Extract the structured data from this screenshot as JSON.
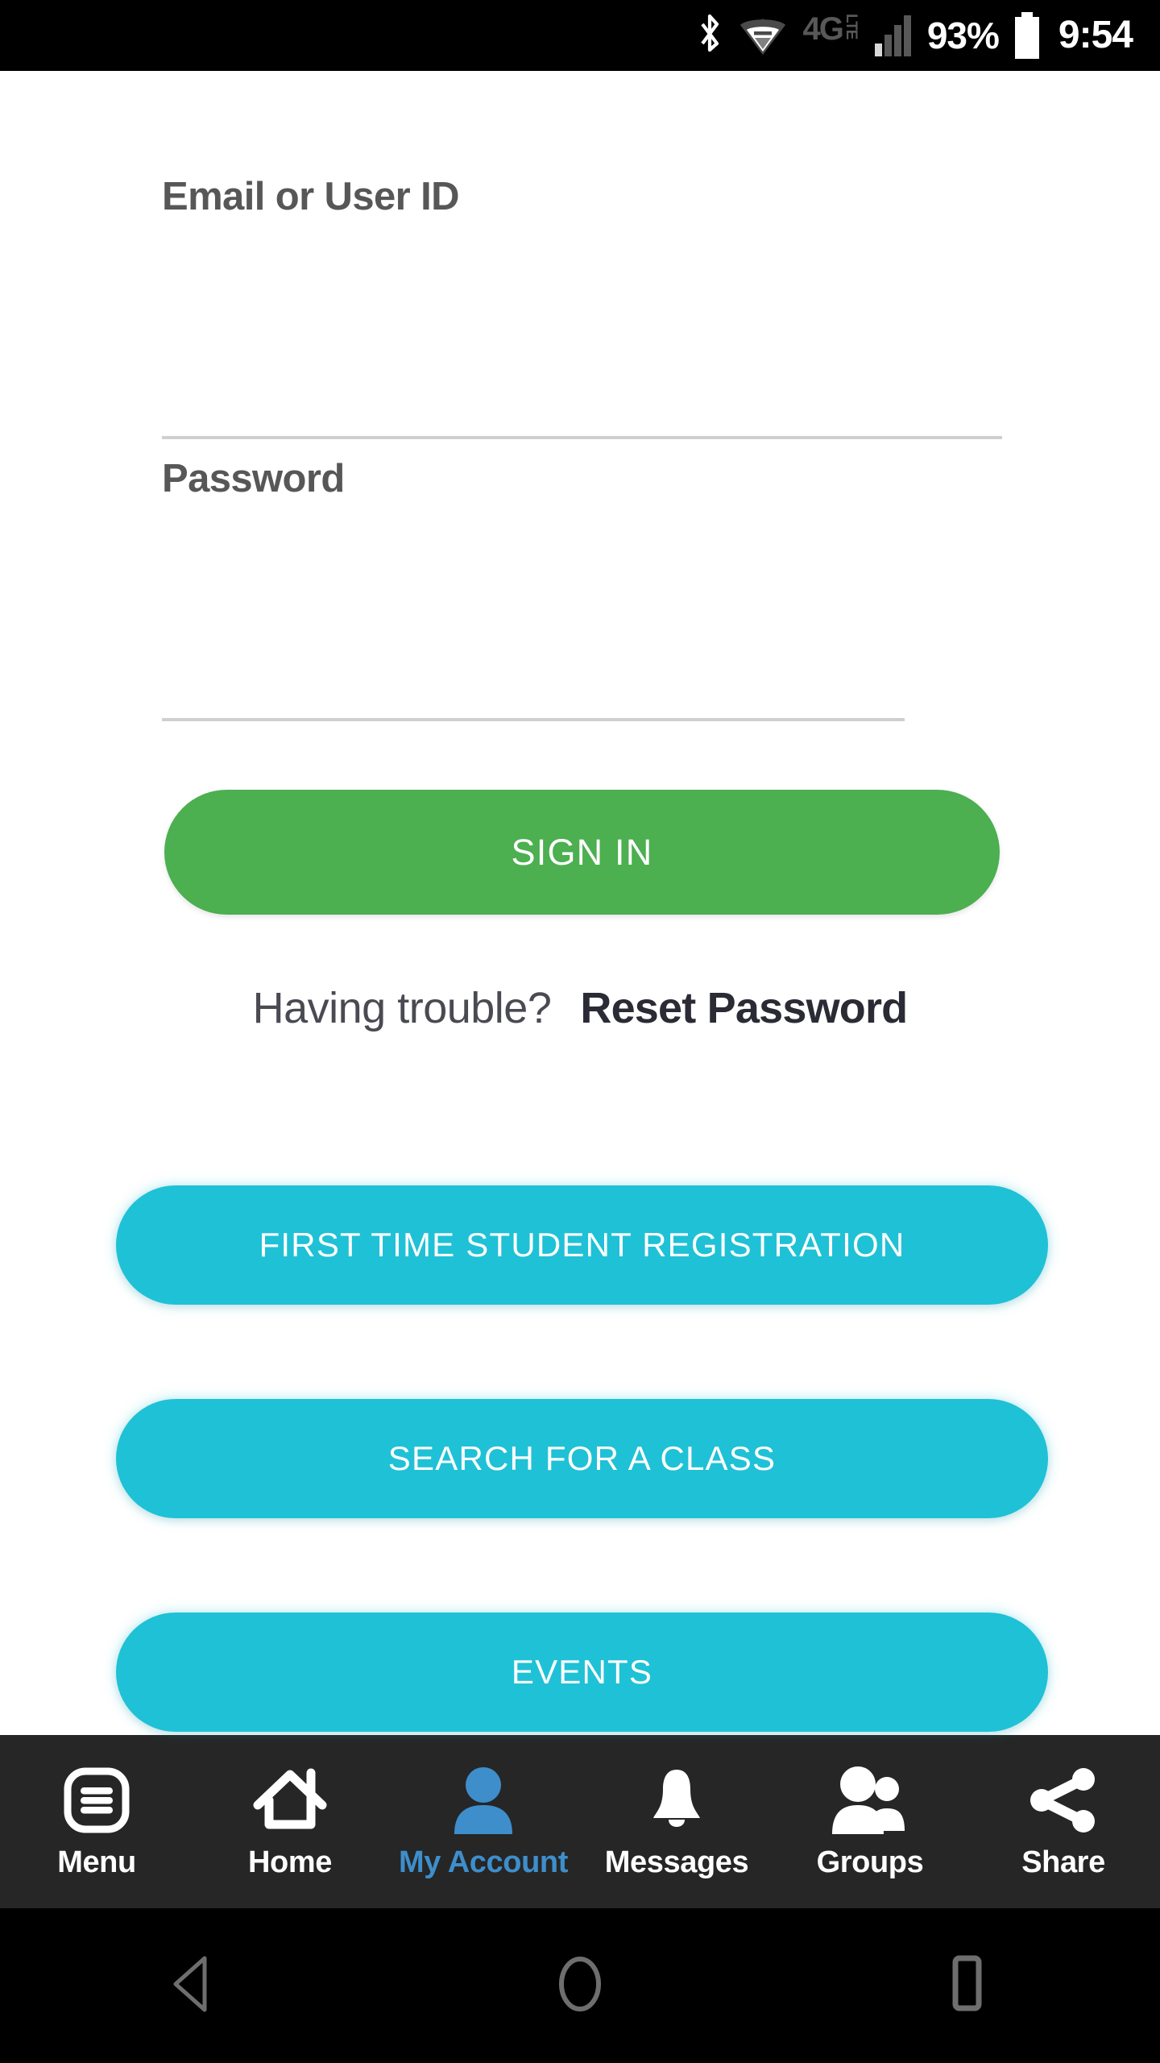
{
  "status_bar": {
    "bluetooth_icon": "bluetooth-icon",
    "wifi_icon": "wifi-icon",
    "network_type": "4G",
    "network_suffix": "LTE",
    "signal_icon": "signal-bars-icon",
    "battery_percent": "93%",
    "battery_icon": "battery-full-icon",
    "time": "9:54"
  },
  "form": {
    "email": {
      "label": "Email or User ID",
      "value": "",
      "placeholder": ""
    },
    "password": {
      "label": "Password",
      "value": "",
      "placeholder": ""
    },
    "sign_in_label": "SIGN IN",
    "trouble_text": "Having trouble?",
    "reset_password_label": "Reset Password"
  },
  "actions": [
    {
      "label": "FIRST TIME STUDENT REGISTRATION",
      "name": "registration"
    },
    {
      "label": "SEARCH FOR A CLASS",
      "name": "search-class"
    },
    {
      "label": "EVENTS",
      "name": "events"
    }
  ],
  "tab_bar": {
    "items": [
      {
        "label": "Menu",
        "icon": "menu-list-icon",
        "active": false
      },
      {
        "label": "Home",
        "icon": "home-icon",
        "active": false
      },
      {
        "label": "My Account",
        "icon": "person-icon",
        "active": true
      },
      {
        "label": "Messages",
        "icon": "bell-icon",
        "active": false
      },
      {
        "label": "Groups",
        "icon": "people-group-icon",
        "active": false
      },
      {
        "label": "Share",
        "icon": "share-icon",
        "active": false
      }
    ]
  },
  "android_nav": {
    "back": "back-triangle-icon",
    "home": "home-circle-icon",
    "recents": "recents-square-icon"
  },
  "colors": {
    "sign_in_green": "#4CAF50",
    "action_cyan": "#1FC1D6",
    "active_tab_blue": "#3E8ECC",
    "label_gray": "#575757",
    "rule_gray": "#CFCFCF",
    "tab_bar_bg": "#262626",
    "status_bar_bg": "#000000"
  }
}
